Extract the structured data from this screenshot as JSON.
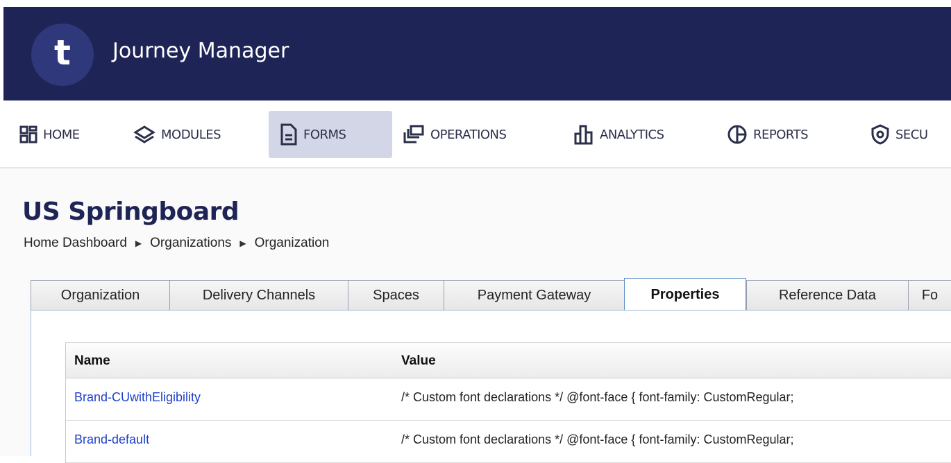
{
  "app": {
    "logo_letter": "t",
    "title": "Journey Manager"
  },
  "nav": [
    {
      "label": "HOME",
      "icon": "grid-icon"
    },
    {
      "label": "MODULES",
      "icon": "layers-icon"
    },
    {
      "label": "FORMS",
      "icon": "document-icon",
      "active": true
    },
    {
      "label": "OPERATIONS",
      "icon": "windows-icon"
    },
    {
      "label": "ANALYTICS",
      "icon": "bar-chart-icon"
    },
    {
      "label": "REPORTS",
      "icon": "pie-chart-icon"
    },
    {
      "label": "SECU",
      "icon": "shield-icon"
    }
  ],
  "page": {
    "title": "US Springboard",
    "breadcrumb": [
      "Home Dashboard",
      "Organizations",
      "Organization"
    ]
  },
  "tabs": [
    {
      "label": "Organization"
    },
    {
      "label": "Delivery Channels"
    },
    {
      "label": "Spaces"
    },
    {
      "label": "Payment Gateway"
    },
    {
      "label": "Properties",
      "active": true
    },
    {
      "label": "Reference Data"
    },
    {
      "label": "Fo"
    }
  ],
  "table": {
    "headers": {
      "name": "Name",
      "value": "Value"
    },
    "rows": [
      {
        "name": "Brand-CUwithEligibility",
        "value": "/* Custom font declarations */ @font-face { font-family: CustomRegular;"
      },
      {
        "name": "Brand-default",
        "value": "/* Custom font declarations */ @font-face { font-family: CustomRegular;"
      }
    ]
  },
  "colors": {
    "header_bg": "#1e2556",
    "logo_bg": "#30387c",
    "active_nav_bg": "#d3d6e6",
    "link": "#1f3fc9"
  }
}
